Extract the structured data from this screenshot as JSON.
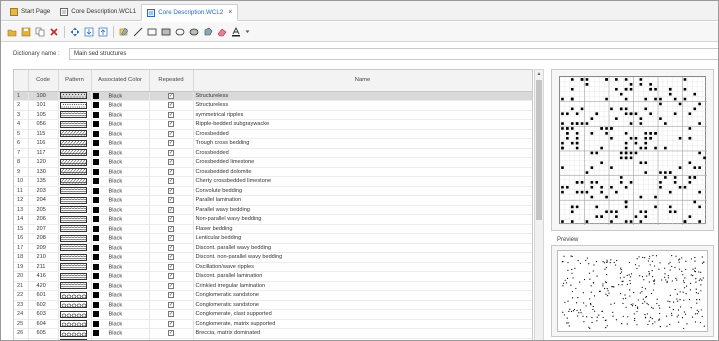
{
  "tabs": [
    {
      "label": "Start Page",
      "active": false,
      "icon": "start-page-icon"
    },
    {
      "label": "Core Description.WCL1",
      "active": false,
      "icon": "document-icon"
    },
    {
      "label": "Core Description.WCL2",
      "active": true,
      "icon": "document-icon",
      "closable": true
    }
  ],
  "toolbar": {
    "icons": [
      "open-icon",
      "save-icon",
      "copy-icon",
      "delete-icon",
      "move-icon",
      "import-icon",
      "export-icon",
      "edit-pattern-icon",
      "line-icon",
      "rectangle-icon",
      "filled-rectangle-icon",
      "ellipse-icon",
      "filled-ellipse-icon",
      "polygon-icon",
      "eraser-icon",
      "text-color-icon",
      "dropdown-icon"
    ],
    "colors": {
      "accent": "#2a6bb5",
      "selected_row": "#d9d9d9",
      "header_bg": "#f3f3f3"
    }
  },
  "dictionary": {
    "label": "Dictionary name :",
    "value": "Main sed structures"
  },
  "table": {
    "columns": [
      "Code",
      "Pattern",
      "Associated Color",
      "Repeated",
      "Name"
    ],
    "rows": [
      {
        "num": "1",
        "code": "100",
        "color": "Black",
        "repeated": true,
        "name": "Structureless",
        "pattern": "dots",
        "selected": true
      },
      {
        "num": "2",
        "code": "101",
        "color": "Black",
        "repeated": true,
        "name": "Structureless",
        "pattern": "dots-fine"
      },
      {
        "num": "3",
        "code": "105",
        "color": "Black",
        "repeated": true,
        "name": "symmetrical ripples",
        "pattern": "ripples"
      },
      {
        "num": "4",
        "code": "056",
        "color": "Black",
        "repeated": true,
        "name": "Ripple-bedded subgraywacke",
        "pattern": "ripple-lines"
      },
      {
        "num": "5",
        "code": "115",
        "color": "Black",
        "repeated": true,
        "name": "Crossbedded",
        "pattern": "cross"
      },
      {
        "num": "6",
        "code": "116",
        "color": "Black",
        "repeated": true,
        "name": "Trough cross bedding",
        "pattern": "trough"
      },
      {
        "num": "7",
        "code": "117",
        "color": "Black",
        "repeated": true,
        "name": "Crossbedded",
        "pattern": "cross-dense"
      },
      {
        "num": "8",
        "code": "120",
        "color": "Black",
        "repeated": true,
        "name": "Crossbedded limestone",
        "pattern": "lime"
      },
      {
        "num": "9",
        "code": "130",
        "color": "Black",
        "repeated": true,
        "name": "Crossbedded dolomite",
        "pattern": "dolo"
      },
      {
        "num": "10",
        "code": "135",
        "color": "Black",
        "repeated": true,
        "name": "Cherty crossbedded limestone",
        "pattern": "chert"
      },
      {
        "num": "11",
        "code": "203",
        "color": "Black",
        "repeated": true,
        "name": "Convolute bedding",
        "pattern": "convolute"
      },
      {
        "num": "12",
        "code": "204",
        "color": "Black",
        "repeated": true,
        "name": "Parallel lamination",
        "pattern": "parallel"
      },
      {
        "num": "13",
        "code": "205",
        "color": "Black",
        "repeated": true,
        "name": "Parallel wavy bedding",
        "pattern": "wavy"
      },
      {
        "num": "14",
        "code": "206",
        "color": "Black",
        "repeated": true,
        "name": "Non-parallel wavy bedding",
        "pattern": "wavy2"
      },
      {
        "num": "15",
        "code": "207",
        "color": "Black",
        "repeated": true,
        "name": "Flaser bedding",
        "pattern": "flaser"
      },
      {
        "num": "16",
        "code": "208",
        "color": "Black",
        "repeated": true,
        "name": "Lenticular bedding",
        "pattern": "lenticular"
      },
      {
        "num": "17",
        "code": "209",
        "color": "Black",
        "repeated": true,
        "name": "Discont. parallel wavy bedding",
        "pattern": "discont"
      },
      {
        "num": "18",
        "code": "210",
        "color": "Black",
        "repeated": true,
        "name": "Discont. non-parallel wavy bedding",
        "pattern": "discont2"
      },
      {
        "num": "19",
        "code": "211",
        "color": "Black",
        "repeated": true,
        "name": "Oscillation/wave ripples",
        "pattern": "osc"
      },
      {
        "num": "20",
        "code": "416",
        "color": "Black",
        "repeated": true,
        "name": "Discont. parallel lamination",
        "pattern": "discont3"
      },
      {
        "num": "21",
        "code": "420",
        "color": "Black",
        "repeated": true,
        "name": "Crinkled irregular lamination",
        "pattern": "crinkle"
      },
      {
        "num": "22",
        "code": "601",
        "color": "Black",
        "repeated": true,
        "name": "Conglomeratic sandstone",
        "pattern": "cong"
      },
      {
        "num": "23",
        "code": "602",
        "color": "Black",
        "repeated": true,
        "name": "Conglomeratic sandstone",
        "pattern": "cong2"
      },
      {
        "num": "24",
        "code": "603",
        "color": "Black",
        "repeated": true,
        "name": "Conglomerate, clast supported",
        "pattern": "clast"
      },
      {
        "num": "25",
        "code": "604",
        "color": "Black",
        "repeated": true,
        "name": "Conglomerate, matrix supported",
        "pattern": "matrix"
      },
      {
        "num": "26",
        "code": "605",
        "color": "Black",
        "repeated": true,
        "name": "Breccia, matrix dominated",
        "pattern": "breccia"
      },
      {
        "num": "27",
        "code": "606",
        "color": "Black",
        "repeated": true,
        "name": "Breccia, clast dominated",
        "pattern": "breccia2"
      }
    ]
  },
  "preview": {
    "label": "Preview"
  }
}
